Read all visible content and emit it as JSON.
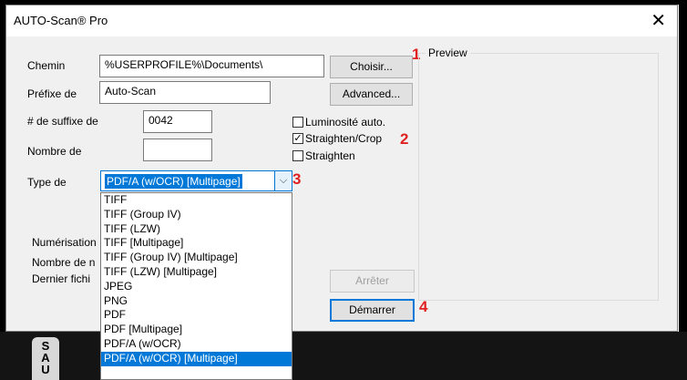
{
  "window": {
    "title": "AUTO-Scan® Pro",
    "close_glyph": "✕"
  },
  "labels": {
    "path": "Chemin",
    "prefix": "Préfixe de",
    "suffix": "# de suffixe de",
    "count": "Nombre de",
    "type": "Type de",
    "scan_status": "Numérisation",
    "count2": "Nombre de n",
    "last_file": "Dernier fichi"
  },
  "fields": {
    "path_value": "%USERPROFILE%\\Documents\\",
    "prefix_value": "Auto-Scan",
    "suffix_value": "0042",
    "count_value": ""
  },
  "buttons": {
    "choose": "Choisir...",
    "advanced": "Advanced...",
    "stop": "Arrêter",
    "start": "Démarrer"
  },
  "checkboxes": [
    {
      "label": "Luminosité auto.",
      "checked": false
    },
    {
      "label": "Straighten/Crop",
      "checked": true
    },
    {
      "label": "Straighten",
      "checked": false
    }
  ],
  "preview": {
    "label": "Preview"
  },
  "file_type": {
    "selected": "PDF/A (w/OCR) [Multipage]",
    "options": [
      "TIFF",
      "TIFF (Group IV)",
      "TIFF (LZW)",
      "TIFF [Multipage]",
      "TIFF (Group IV) [Multipage]",
      "TIFF (LZW) [Multipage]",
      "JPEG",
      "PNG",
      "PDF",
      "PDF [Multipage]",
      "PDF/A (w/OCR)",
      "PDF/A (w/OCR) [Multipage]"
    ]
  },
  "markers": {
    "m1": "1",
    "m2": "2",
    "m3": "3",
    "m4": "4"
  },
  "app_icon_letters": [
    "S",
    "A",
    "U"
  ],
  "colors": {
    "accent": "#0078d7",
    "marker": "#e02020"
  },
  "icons": {
    "close": "close-icon",
    "dropdown": "chevron-down-icon"
  }
}
